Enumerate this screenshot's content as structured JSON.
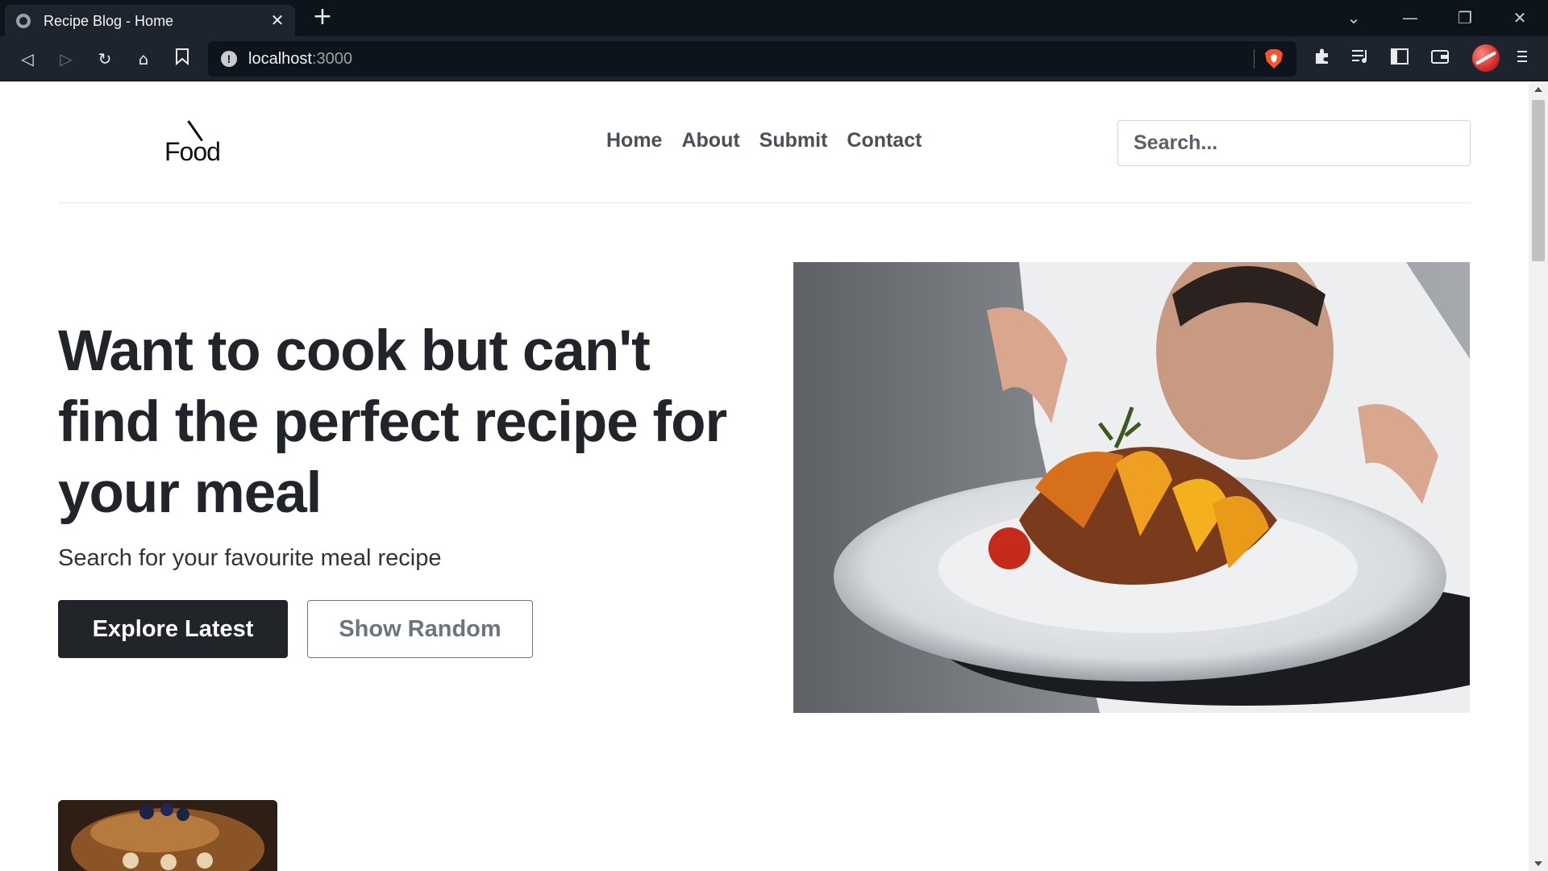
{
  "browser": {
    "tab_title": "Recipe Blog - Home",
    "tab_close": "✕",
    "new_tab": "+",
    "url_host": "localhost",
    "url_port": ":3000",
    "info_icon": "!",
    "window_controls": {
      "dropdown": "⌄",
      "minimize": "—",
      "restore": "❐",
      "close": "✕"
    },
    "toolbar_icons": {
      "back": "◁",
      "forward": "▷",
      "reload": "↻",
      "home": "⌂",
      "bookmark": "☐"
    }
  },
  "site": {
    "logo_text": "Food",
    "nav": [
      "Home",
      "About",
      "Submit",
      "Contact"
    ],
    "search_placeholder": "Search..."
  },
  "hero": {
    "heading": "Want to cook but can't find the perfect recipe for your meal",
    "subheading": "Search for your favourite meal recipe",
    "primary_button": "Explore Latest",
    "secondary_button": "Show Random"
  },
  "colors": {
    "chrome_dark": "#0e141c",
    "toolbar": "#1e242e",
    "text_dark": "#212529",
    "nav_text": "#4a5058",
    "outline_button": "#6c757d",
    "brave_orange": "#fb542b"
  }
}
